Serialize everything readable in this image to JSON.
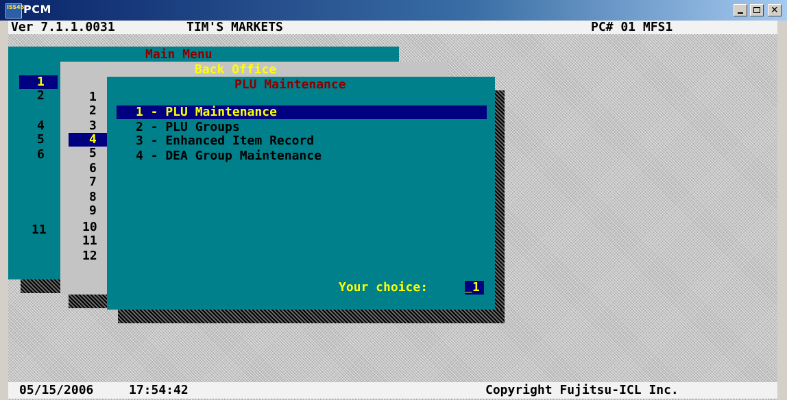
{
  "window": {
    "title": "PCM",
    "icon": "ISS45",
    "controls": [
      "minimize",
      "maximize",
      "close"
    ]
  },
  "header": {
    "version": "Ver 7.1.1.0031",
    "store": "TIM'S MARKETS",
    "pc": "PC# 01 MFS1"
  },
  "main_menu": {
    "title": "Main Menu",
    "numbers": [
      "1",
      "2",
      "4",
      "5",
      "6",
      "11"
    ],
    "selected": "1"
  },
  "back_office": {
    "title": "Back Office",
    "numbers": [
      "1",
      "2",
      "3",
      "4",
      "5",
      "6",
      "7",
      "8",
      "9",
      "10",
      "11",
      "12"
    ],
    "selected": "4"
  },
  "plu_menu": {
    "title": "PLU Maintenance",
    "items": [
      {
        "label": "1 - PLU Maintenance"
      },
      {
        "label": "2 - PLU Groups"
      },
      {
        "label": "3 - Enhanced Item Record"
      },
      {
        "label": "4 - DEA Group Maintenance"
      }
    ],
    "selected_index": 0,
    "prompt": "Your choice:",
    "choice_value": "1"
  },
  "footer": {
    "date": "05/15/2006",
    "time": "17:54:42",
    "copyright": "Copyright Fujitsu-ICL Inc."
  },
  "colors": {
    "teal": "#00808a",
    "highlight": "#000080",
    "yellow": "#ffff00",
    "title_red": "#8b0000",
    "gray": "#c4c4c4"
  }
}
